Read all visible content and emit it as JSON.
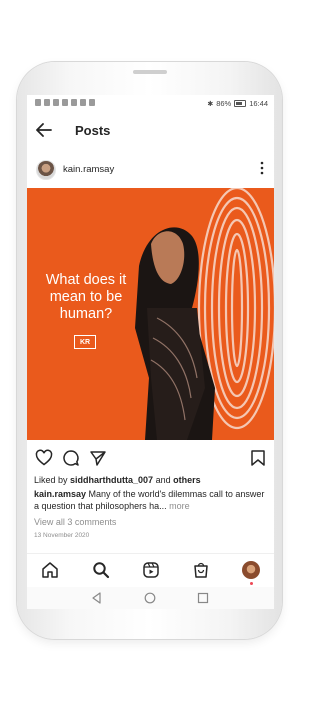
{
  "status": {
    "battery": "86%",
    "time": "16:44"
  },
  "header": {
    "title": "Posts"
  },
  "post": {
    "username": "kain.ramsay",
    "image_text": [
      "What does it",
      "mean to be",
      "human?"
    ],
    "logo_text": "KR",
    "likes_prefix": "Liked by ",
    "likes_user": "siddharthdutta_007",
    "likes_mid": " and ",
    "likes_others": "others",
    "caption_user": "kain.ramsay",
    "caption_text": " Many of the world's dilemmas call to answer a question that philosophers ha...",
    "caption_more": " more",
    "view_comments": "View all 3 comments",
    "date": "13 November 2020"
  },
  "colors": {
    "post_bg": "#ea5a1c",
    "notification_dot": "#ed4956"
  }
}
